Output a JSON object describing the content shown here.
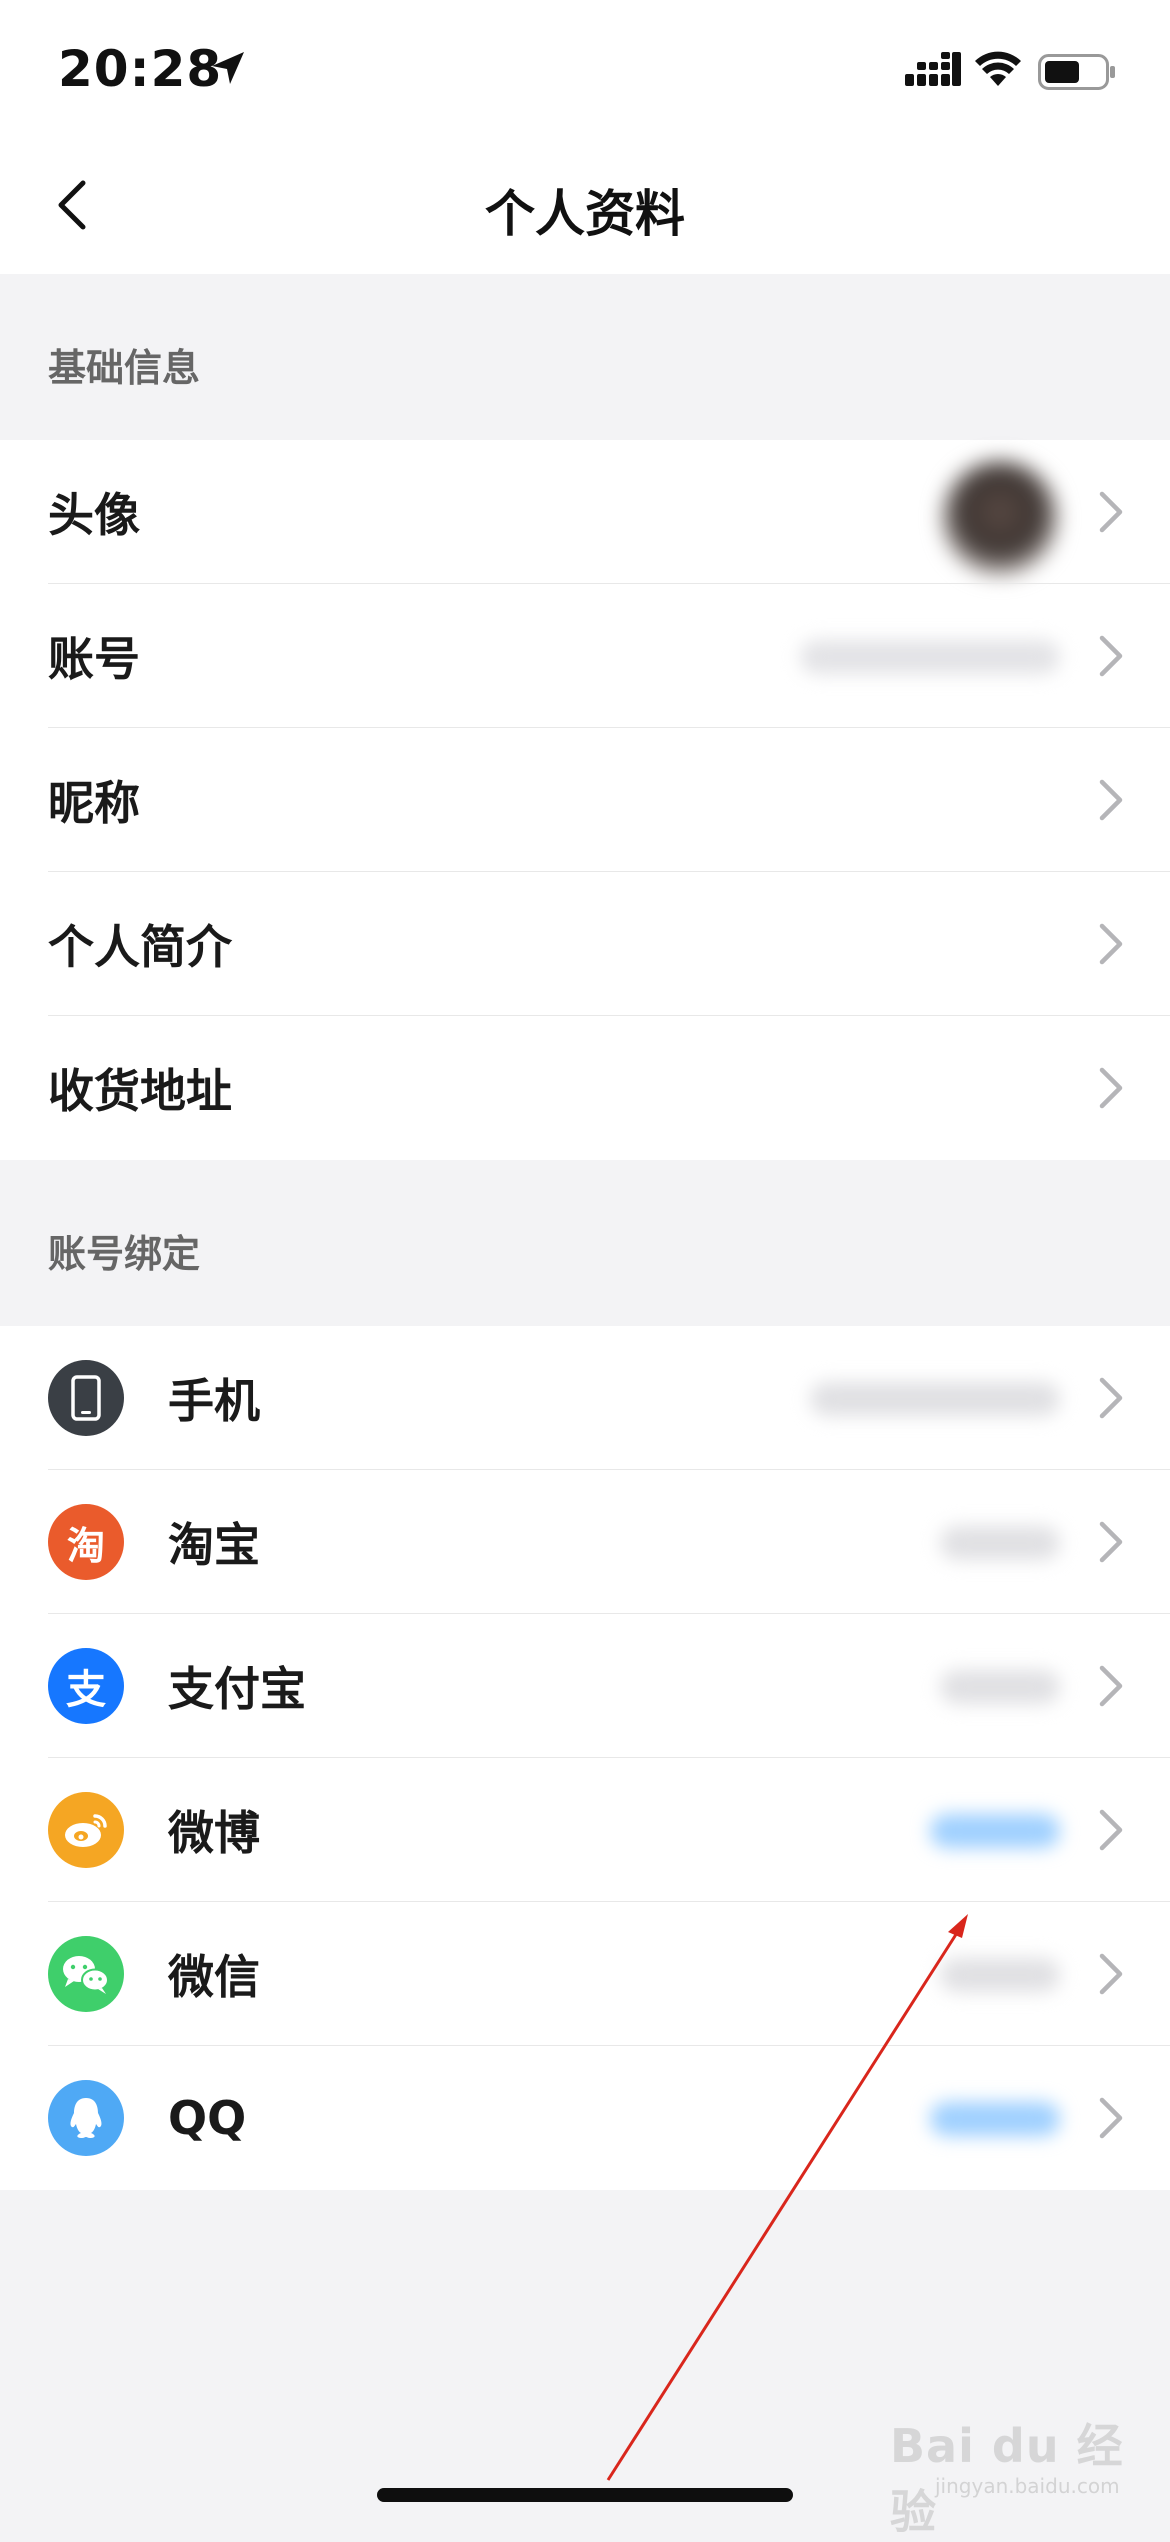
{
  "status_bar": {
    "time": "20:28"
  },
  "nav": {
    "title": "个人资料"
  },
  "sections": {
    "basic": {
      "title": "基础信息",
      "items": [
        {
          "label": "头像",
          "icon": "avatar-image"
        },
        {
          "label": "账号"
        },
        {
          "label": "昵称"
        },
        {
          "label": "个人简介"
        },
        {
          "label": "收货地址"
        }
      ]
    },
    "binding": {
      "title": "账号绑定",
      "items": [
        {
          "label": "手机",
          "icon": "phone-icon",
          "color": "#3a3f45"
        },
        {
          "label": "淘宝",
          "icon": "taobao-icon",
          "color": "#ea5b2c"
        },
        {
          "label": "支付宝",
          "icon": "alipay-icon",
          "color": "#1677ff"
        },
        {
          "label": "微博",
          "icon": "weibo-icon",
          "color": "#f5a623"
        },
        {
          "label": "微信",
          "icon": "wechat-icon",
          "color": "#3fcf6b"
        },
        {
          "label": "QQ",
          "icon": "qq-icon",
          "color": "#4fa9f5"
        }
      ]
    }
  },
  "taobao_glyph": "淘",
  "alipay_glyph": "支",
  "watermark": {
    "brand": "Bai du 经验",
    "url": "jingyan.baidu.com"
  },
  "colors": {
    "accent_blue_blur": "#9fd0ff",
    "annotation_arrow": "#d9261c"
  }
}
